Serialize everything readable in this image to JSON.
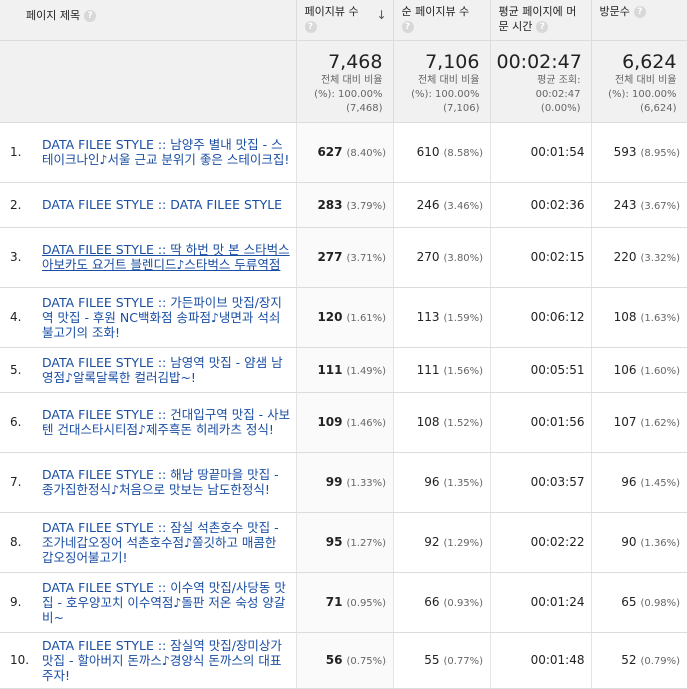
{
  "columns": {
    "title": "페이지 제목",
    "pageviews": "페이지뷰 수",
    "unique_pageviews": "순 페이지뷰 수",
    "avg_time": "평균 페이지에 머문 시간",
    "visits": "방문수"
  },
  "totals": {
    "pageviews": {
      "value": "7,468",
      "l1": "전체 대비 비율",
      "l2": "(%): 100.00%",
      "l3": "(7,468)"
    },
    "unique_pageviews": {
      "value": "7,106",
      "l1": "전체 대비 비율",
      "l2": "(%): 100.00%",
      "l3": "(7,106)"
    },
    "avg_time": {
      "value": "00:02:47",
      "l1": "평균 조회:",
      "l2": "00:02:47",
      "l3": "(0.00%)"
    },
    "visits": {
      "value": "6,624",
      "l1": "전체 대비 비율",
      "l2": "(%): 100.00%",
      "l3": "(6,624)"
    }
  },
  "rows": [
    {
      "rank": "1.",
      "title": "DATA FILEE STYLE :: 남양주 별내 맛집 - 스테이크나인♪서울 근교 분위기 좋은 스테이크집!",
      "pv": "627",
      "pv_pct": "(8.40%)",
      "upv": "610",
      "upv_pct": "(8.58%)",
      "avg": "00:01:54",
      "vis": "593",
      "vis_pct": "(8.95%)"
    },
    {
      "rank": "2.",
      "title": "DATA FILEE STYLE :: DATA FILEE STYLE",
      "pv": "283",
      "pv_pct": "(3.79%)",
      "upv": "246",
      "upv_pct": "(3.46%)",
      "avg": "00:02:36",
      "vis": "243",
      "vis_pct": "(3.67%)"
    },
    {
      "rank": "3.",
      "title": "DATA FILEE STYLE :: 딱 하번 맛 본 스타벅스 아보카도 요거트 블렌디드♪스타벅스 두류역점",
      "pv": "277",
      "pv_pct": "(3.71%)",
      "upv": "270",
      "upv_pct": "(3.80%)",
      "avg": "00:02:15",
      "vis": "220",
      "vis_pct": "(3.32%)"
    },
    {
      "rank": "4.",
      "title": "DATA FILEE STYLE :: 가든파이브 맛집/장지역 맛집 - 후원 NC백화점 송파점♪냉면과 석쇠불고기의 조화!",
      "pv": "120",
      "pv_pct": "(1.61%)",
      "upv": "113",
      "upv_pct": "(1.59%)",
      "avg": "00:06:12",
      "vis": "108",
      "vis_pct": "(1.63%)"
    },
    {
      "rank": "5.",
      "title": "DATA FILEE STYLE :: 남영역 맛집 - 얌샘 남영점♪알록달록한 컬러김밥~!",
      "pv": "111",
      "pv_pct": "(1.49%)",
      "upv": "111",
      "upv_pct": "(1.56%)",
      "avg": "00:05:51",
      "vis": "106",
      "vis_pct": "(1.60%)"
    },
    {
      "rank": "6.",
      "title": "DATA FILEE STYLE :: 건대입구역 맛집 - 사보텐 건대스타시티점♪제주흑돈 히레카츠 정식!",
      "pv": "109",
      "pv_pct": "(1.46%)",
      "upv": "108",
      "upv_pct": "(1.52%)",
      "avg": "00:01:56",
      "vis": "107",
      "vis_pct": "(1.62%)"
    },
    {
      "rank": "7.",
      "title": "DATA FILEE STYLE :: 해남 땅끝마을 맛집 - 종가집한정식♪처음으로 맛보는 남도한정식!",
      "pv": "99",
      "pv_pct": "(1.33%)",
      "upv": "96",
      "upv_pct": "(1.35%)",
      "avg": "00:03:57",
      "vis": "96",
      "vis_pct": "(1.45%)"
    },
    {
      "rank": "8.",
      "title": "DATA FILEE STYLE :: 잠실 석촌호수 맛집 - 조가네갑오징어 석촌호수점♪쫄깃하고 매콤한 갑오징어불고기!",
      "pv": "95",
      "pv_pct": "(1.27%)",
      "upv": "92",
      "upv_pct": "(1.29%)",
      "avg": "00:02:22",
      "vis": "90",
      "vis_pct": "(1.36%)"
    },
    {
      "rank": "9.",
      "title": "DATA FILEE STYLE :: 이수역 맛집/사당동 맛집 - 호우양꼬치 이수역점♪돌판 저온 숙성 양갈비~",
      "pv": "71",
      "pv_pct": "(0.95%)",
      "upv": "66",
      "upv_pct": "(0.93%)",
      "avg": "00:01:24",
      "vis": "65",
      "vis_pct": "(0.98%)"
    },
    {
      "rank": "10.",
      "title": "DATA FILEE STYLE :: 잠실역 맛집/장미상가 맛집 - 할아버지 돈까스♪경양식 돈까스의 대표주자!",
      "pv": "56",
      "pv_pct": "(0.75%)",
      "upv": "55",
      "upv_pct": "(0.77%)",
      "avg": "00:01:48",
      "vis": "52",
      "vis_pct": "(0.79%)"
    }
  ]
}
